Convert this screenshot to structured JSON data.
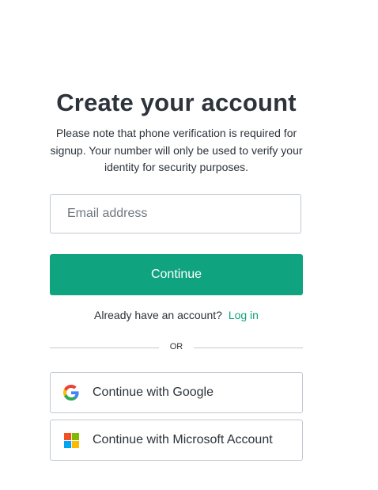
{
  "header": {
    "title": "Create your account",
    "subtitle": "Please note that phone verification is required for signup. Your number will only be used to verify your identity for security purposes."
  },
  "form": {
    "email_placeholder": "Email address",
    "email_value": "",
    "continue_label": "Continue"
  },
  "login": {
    "prompt": "Already have an account?",
    "link_label": "Log in"
  },
  "divider": {
    "label": "OR"
  },
  "social": {
    "google_label": "Continue with Google",
    "google_icon": "google-icon",
    "microsoft_label": "Continue with Microsoft Account",
    "microsoft_icon": "microsoft-icon"
  },
  "colors": {
    "accent": "#10a37f",
    "text": "#2d333a",
    "border": "#c2c8d0"
  }
}
